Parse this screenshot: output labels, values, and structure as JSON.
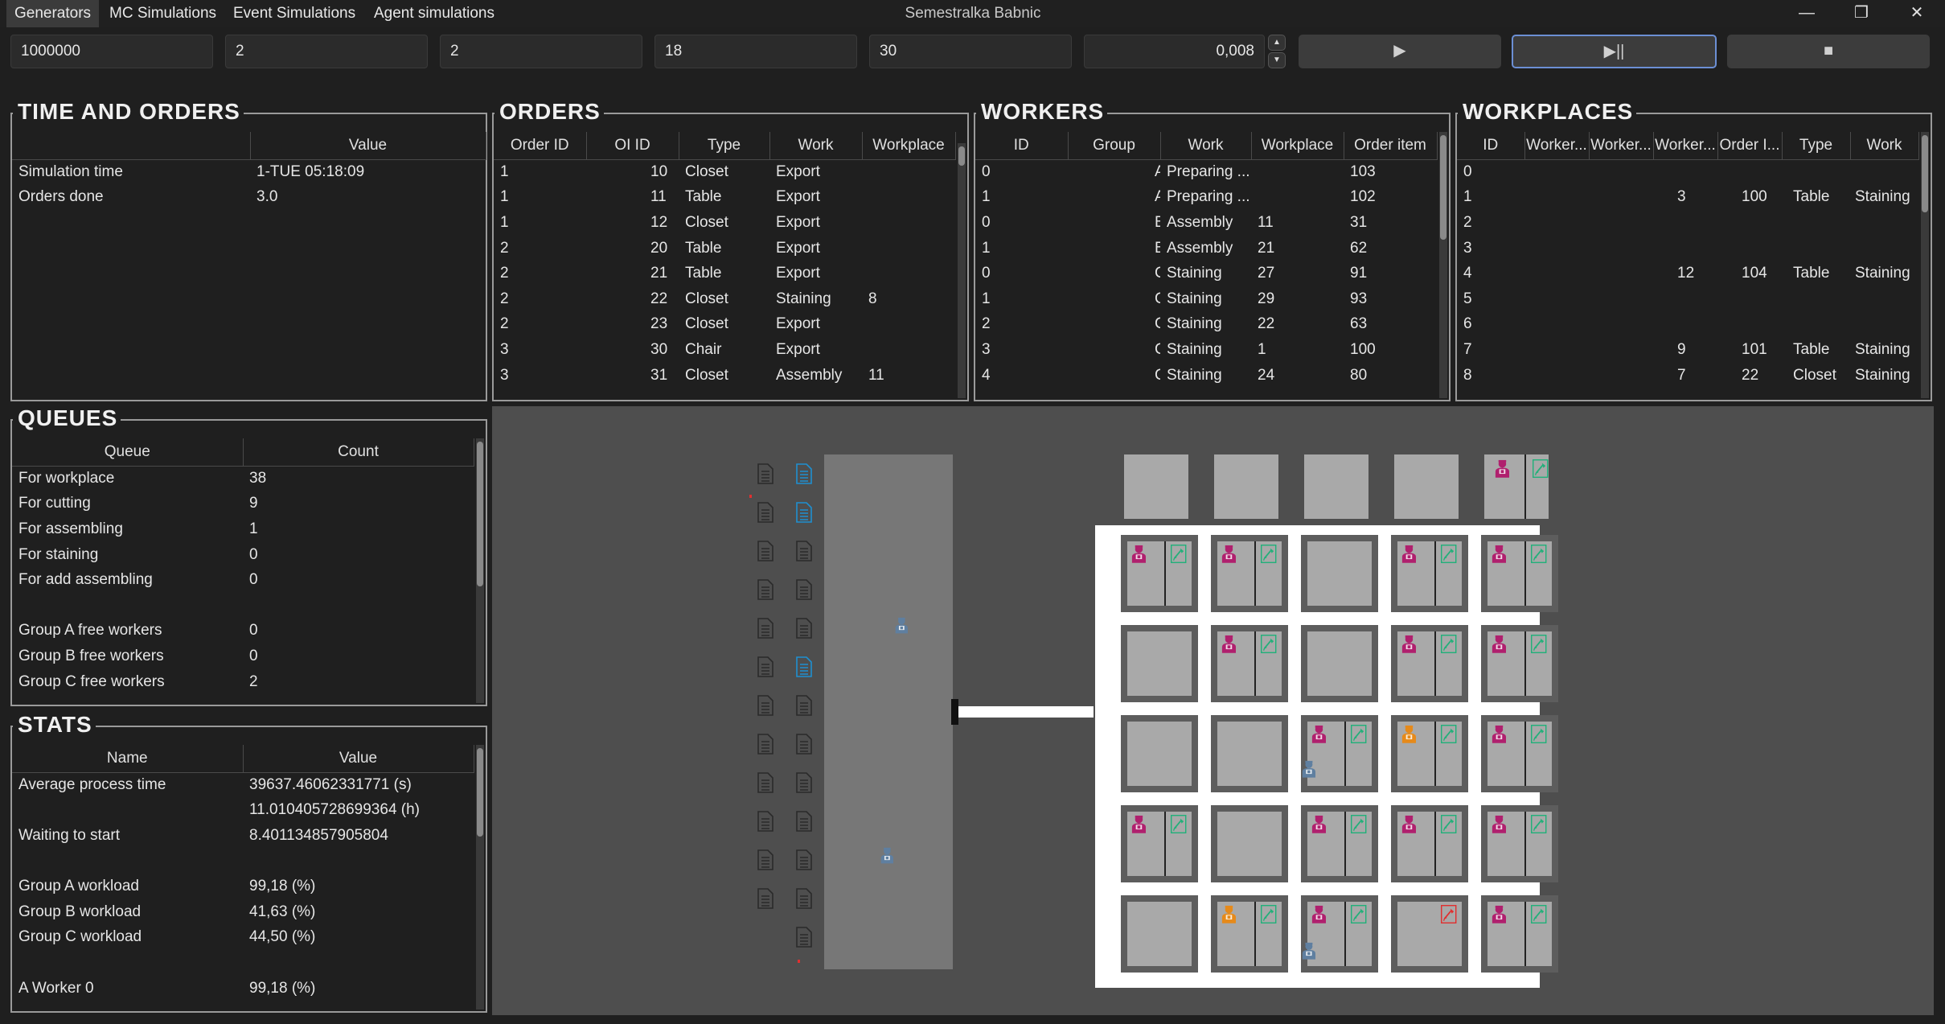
{
  "window": {
    "title": "Semestralka Babnic",
    "tabs": [
      "Generators",
      "MC Simulations",
      "Event Simulations",
      "Agent simulations"
    ],
    "controls": [
      "minimize-icon",
      "restore-icon",
      "close-icon"
    ]
  },
  "params": {
    "replications": "1000000",
    "group_a": "2",
    "group_b": "2",
    "group_c": "18",
    "workplaces": "30",
    "speed": "0,008"
  },
  "buttons": {
    "start_icon": "▶",
    "pause_icon": "▶||",
    "stop_icon": "■"
  },
  "time_orders": {
    "title": "TIME AND ORDERS",
    "columns": [
      "",
      "Value"
    ],
    "rows": [
      [
        "Simulation time",
        "1-TUE 05:18:09"
      ],
      [
        "Orders done",
        "3.0"
      ]
    ]
  },
  "orders": {
    "title": "ORDERS",
    "columns": [
      "Order ID",
      "OI ID",
      "Type",
      "Work",
      "Workplace"
    ],
    "rows": [
      [
        "1",
        "10",
        "Closet",
        "Export",
        ""
      ],
      [
        "1",
        "11",
        "Table",
        "Export",
        ""
      ],
      [
        "1",
        "12",
        "Closet",
        "Export",
        ""
      ],
      [
        "2",
        "20",
        "Table",
        "Export",
        ""
      ],
      [
        "2",
        "21",
        "Table",
        "Export",
        ""
      ],
      [
        "2",
        "22",
        "Closet",
        "Staining",
        "8"
      ],
      [
        "2",
        "23",
        "Closet",
        "Export",
        ""
      ],
      [
        "3",
        "30",
        "Chair",
        "Export",
        ""
      ],
      [
        "3",
        "31",
        "Closet",
        "Assembly",
        "11"
      ]
    ]
  },
  "workers": {
    "title": "WORKERS",
    "columns": [
      "ID",
      "Group",
      "Work",
      "Workplace",
      "Order item"
    ],
    "rows": [
      [
        "0",
        "A",
        "Preparing ...",
        "",
        "103"
      ],
      [
        "1",
        "A",
        "Preparing ...",
        "",
        "102"
      ],
      [
        "0",
        "B",
        "Assembly",
        "11",
        "31"
      ],
      [
        "1",
        "B",
        "Assembly",
        "21",
        "62"
      ],
      [
        "0",
        "C",
        "Staining",
        "27",
        "91"
      ],
      [
        "1",
        "C",
        "Staining",
        "29",
        "93"
      ],
      [
        "2",
        "C",
        "Staining",
        "22",
        "63"
      ],
      [
        "3",
        "C",
        "Staining",
        "1",
        "100"
      ],
      [
        "4",
        "C",
        "Staining",
        "24",
        "80"
      ]
    ]
  },
  "workplaces": {
    "title": "WORKPLACES",
    "columns": [
      "ID",
      "Worker...",
      "Worker...",
      "Worker...",
      "Order I...",
      "Type",
      "Work"
    ],
    "rows": [
      [
        "0",
        "",
        "",
        "",
        "",
        "",
        ""
      ],
      [
        "1",
        "",
        "",
        "3",
        "100",
        "Table",
        "Staining"
      ],
      [
        "2",
        "",
        "",
        "",
        "",
        "",
        ""
      ],
      [
        "3",
        "",
        "",
        "",
        "",
        "",
        ""
      ],
      [
        "4",
        "",
        "",
        "12",
        "104",
        "Table",
        "Staining"
      ],
      [
        "5",
        "",
        "",
        "",
        "",
        "",
        ""
      ],
      [
        "6",
        "",
        "",
        "",
        "",
        "",
        ""
      ],
      [
        "7",
        "",
        "",
        "9",
        "101",
        "Table",
        "Staining"
      ],
      [
        "8",
        "",
        "",
        "7",
        "22",
        "Closet",
        "Staining"
      ]
    ]
  },
  "queues": {
    "title": "QUEUES",
    "columns": [
      "Queue",
      "Count"
    ],
    "rows": [
      [
        "For workplace",
        "38"
      ],
      [
        "For cutting",
        "9"
      ],
      [
        "For assembling",
        "1"
      ],
      [
        "For staining",
        "0"
      ],
      [
        "For add assembling",
        "0"
      ],
      [
        "",
        ""
      ],
      [
        "Group A free workers",
        "0"
      ],
      [
        "Group B free workers",
        "0"
      ],
      [
        "Group C free workers",
        "2"
      ]
    ]
  },
  "stats": {
    "title": "STATS",
    "columns": [
      "Name",
      "Value"
    ],
    "rows": [
      [
        "Average process time",
        "39637.46062331771 (s)"
      ],
      [
        "",
        "11.010405728699364 (h)"
      ],
      [
        "Waiting to start",
        "8.401134857905804"
      ],
      [
        "",
        ""
      ],
      [
        "Group A workload",
        "99,18 (%)"
      ],
      [
        "Group B workload",
        "41,63 (%)"
      ],
      [
        "Group C workload",
        "44,50 (%)"
      ],
      [
        "",
        ""
      ],
      [
        "A Worker 0",
        "99,18 (%)"
      ]
    ]
  },
  "scene": {
    "colors": {
      "background": "#4e4e4e",
      "warehouse": "#777777",
      "tile": "#a9a9a9",
      "frame": "#5d5d5d",
      "track": "#ffffff",
      "worker_a": "#b0206e",
      "worker_b": "#e68a1a",
      "worker_c": "#5f7fa0",
      "doc_active": "#22b07a",
      "doc_error": "#e03030",
      "doc_queued": "#1e8fd0"
    },
    "icons": [
      "document-icon",
      "worker-icon",
      "staining-doc-icon"
    ]
  }
}
